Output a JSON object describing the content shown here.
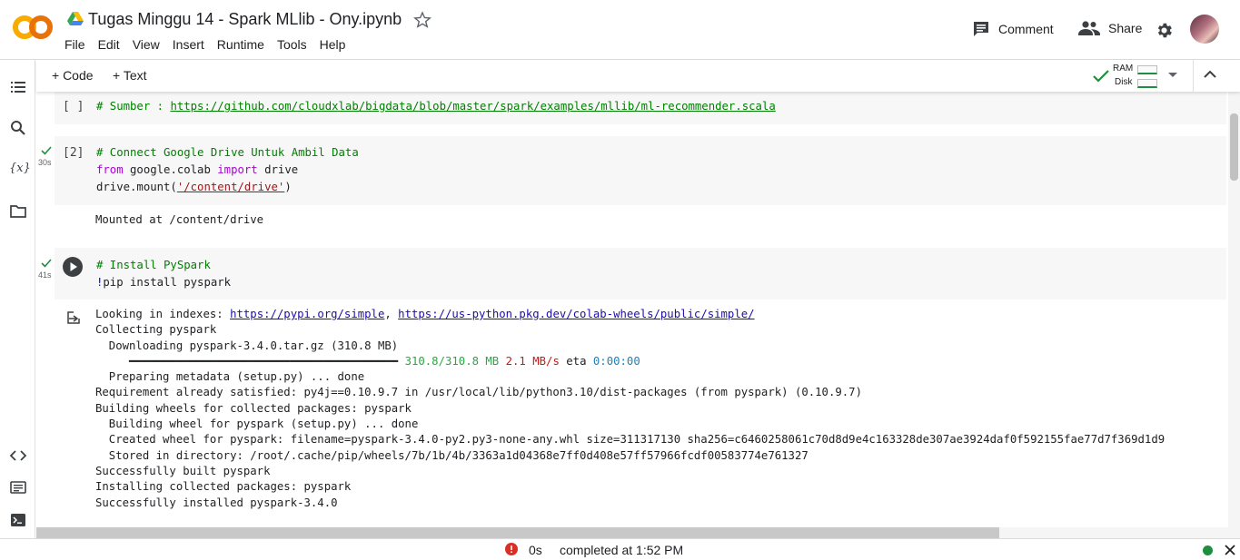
{
  "header": {
    "title": "Tugas Minggu 14 - Spark MLlib - Ony.ipynb",
    "menu": [
      "File",
      "Edit",
      "View",
      "Insert",
      "Runtime",
      "Tools",
      "Help"
    ],
    "comment_label": "Comment",
    "share_label": "Share"
  },
  "toolbar": {
    "code_label": "+ Code",
    "text_label": "+ Text",
    "ram_label": "RAM",
    "disk_label": "Disk"
  },
  "cells": {
    "c1": {
      "exec": "[ ]",
      "comment": "# Sumber : ",
      "url": "https://github.com/cloudxlab/bigdata/blob/master/spark/examples/mllib/ml-recommender.scala"
    },
    "c2": {
      "exec": "[2]",
      "time": "30s",
      "line1": "# Connect Google Drive Untuk Ambil Data",
      "from_kw": "from",
      "module": " google.colab ",
      "import_kw": "import",
      "name": " drive",
      "call": "drive.mount(",
      "arg": "'/content/drive'",
      "close": ")",
      "output": "Mounted at /content/drive"
    },
    "c3": {
      "time": "41s",
      "line1": "# Install PySpark",
      "bang": "!",
      "cmd": "pip install pyspark",
      "out_prefix": "Looking in indexes: ",
      "out_link1": "https://pypi.org/simple",
      "out_sep": ", ",
      "out_link2": "https://us-python.pkg.dev/colab-wheels/public/simple/",
      "out_l2": "Collecting pyspark",
      "out_l3": "  Downloading pyspark-3.4.0.tar.gz (310.8 MB)",
      "out_bar": "     ━━━━━━━━━━━━━━━━━━━━━━━━━━━━━━━━━━━━━━━━ ",
      "out_bar_size": "310.8/310.8 MB",
      "out_bar_speed": "2.1",
      "out_bar_unit": " MB/s",
      "out_bar_eta_lbl": " eta ",
      "out_bar_eta": "0:00:00",
      "out_l5": "  Preparing metadata (setup.py) ... done",
      "out_l6": "Requirement already satisfied: py4j==0.10.9.7 in /usr/local/lib/python3.10/dist-packages (from pyspark) (0.10.9.7)",
      "out_l7": "Building wheels for collected packages: pyspark",
      "out_l8": "  Building wheel for pyspark (setup.py) ... done",
      "out_l9": "  Created wheel for pyspark: filename=pyspark-3.4.0-py2.py3-none-any.whl size=311317130 sha256=c6460258061c70d8d9e4c163328de307ae3924daf0f592155fae77d7f369d1d9",
      "out_l10": "  Stored in directory: /root/.cache/pip/wheels/7b/1b/4b/3363a1d04368e7ff0d408e57ff57966fcdf00583774e761327",
      "out_l11": "Successfully built pyspark",
      "out_l12": "Installing collected packages: pyspark",
      "out_l13": "Successfully installed pyspark-3.4.0"
    }
  },
  "status": {
    "time": "0s",
    "text": "completed at 1:52 PM"
  },
  "colors": {
    "accent_orange": "#f9ab00",
    "success_green": "#1e8e3e",
    "error_red": "#d93025"
  }
}
